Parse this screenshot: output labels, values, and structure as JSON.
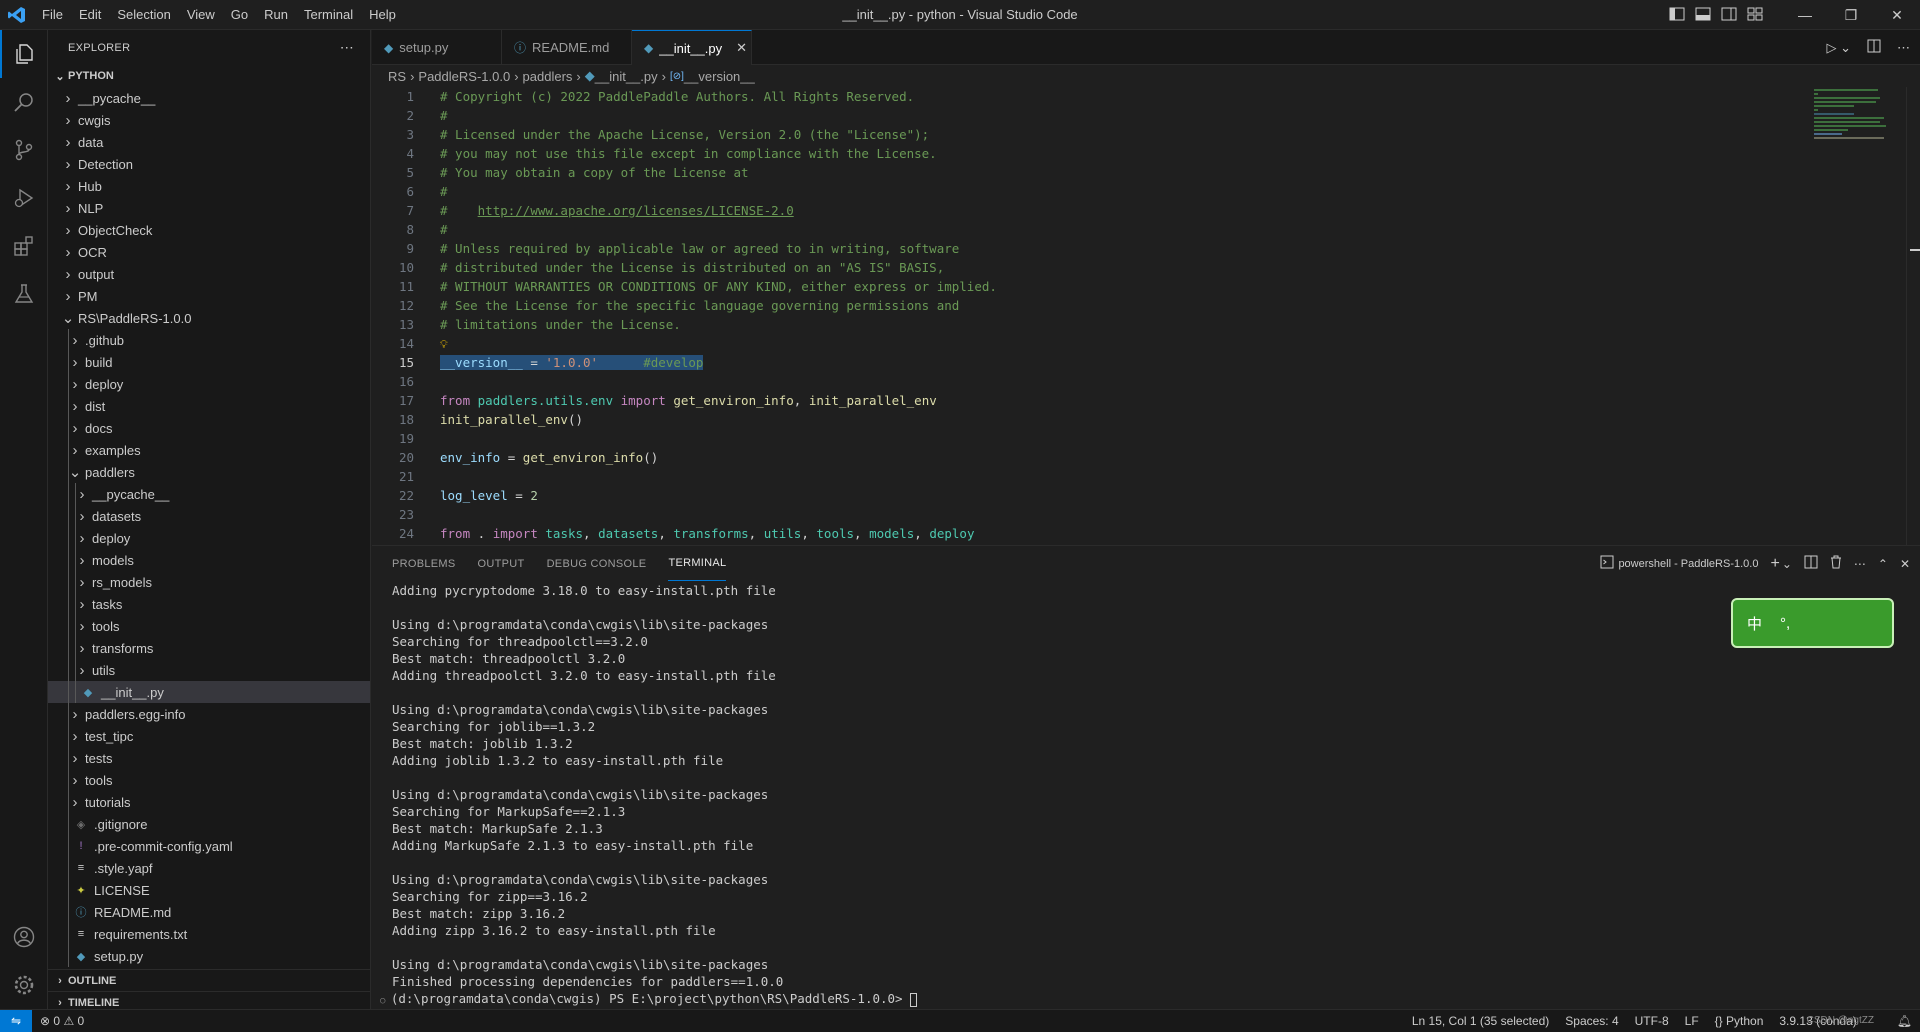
{
  "titlebar": {
    "menu": [
      "File",
      "Edit",
      "Selection",
      "View",
      "Go",
      "Run",
      "Terminal",
      "Help"
    ],
    "title": "__init__.py - python - Visual Studio Code"
  },
  "sidebar": {
    "title": "EXPLORER",
    "root": "PYTHON",
    "tree": [
      {
        "label": "__pycache__",
        "depth": 0,
        "type": "folder"
      },
      {
        "label": "cwgis",
        "depth": 0,
        "type": "folder"
      },
      {
        "label": "data",
        "depth": 0,
        "type": "folder"
      },
      {
        "label": "Detection",
        "depth": 0,
        "type": "folder"
      },
      {
        "label": "Hub",
        "depth": 0,
        "type": "folder"
      },
      {
        "label": "NLP",
        "depth": 0,
        "type": "folder"
      },
      {
        "label": "ObjectCheck",
        "depth": 0,
        "type": "folder"
      },
      {
        "label": "OCR",
        "depth": 0,
        "type": "folder"
      },
      {
        "label": "output",
        "depth": 0,
        "type": "folder"
      },
      {
        "label": "PM",
        "depth": 0,
        "type": "folder"
      },
      {
        "label": "RS\\PaddleRS-1.0.0",
        "depth": 0,
        "type": "open"
      },
      {
        "label": ".github",
        "depth": 1,
        "type": "folder"
      },
      {
        "label": "build",
        "depth": 1,
        "type": "folder"
      },
      {
        "label": "deploy",
        "depth": 1,
        "type": "folder"
      },
      {
        "label": "dist",
        "depth": 1,
        "type": "folder"
      },
      {
        "label": "docs",
        "depth": 1,
        "type": "folder"
      },
      {
        "label": "examples",
        "depth": 1,
        "type": "folder"
      },
      {
        "label": "paddlers",
        "depth": 1,
        "type": "open"
      },
      {
        "label": "__pycache__",
        "depth": 2,
        "type": "folder"
      },
      {
        "label": "datasets",
        "depth": 2,
        "type": "folder"
      },
      {
        "label": "deploy",
        "depth": 2,
        "type": "folder"
      },
      {
        "label": "models",
        "depth": 2,
        "type": "folder"
      },
      {
        "label": "rs_models",
        "depth": 2,
        "type": "folder"
      },
      {
        "label": "tasks",
        "depth": 2,
        "type": "folder"
      },
      {
        "label": "tools",
        "depth": 2,
        "type": "folder"
      },
      {
        "label": "transforms",
        "depth": 2,
        "type": "folder"
      },
      {
        "label": "utils",
        "depth": 2,
        "type": "folder"
      },
      {
        "label": "__init__.py",
        "depth": 2,
        "type": "py",
        "selected": true
      },
      {
        "label": "paddlers.egg-info",
        "depth": 1,
        "type": "folder"
      },
      {
        "label": "test_tipc",
        "depth": 1,
        "type": "folder"
      },
      {
        "label": "tests",
        "depth": 1,
        "type": "folder"
      },
      {
        "label": "tools",
        "depth": 1,
        "type": "folder"
      },
      {
        "label": "tutorials",
        "depth": 1,
        "type": "folder"
      },
      {
        "label": ".gitignore",
        "depth": 1,
        "type": "git"
      },
      {
        "label": ".pre-commit-config.yaml",
        "depth": 1,
        "type": "yaml"
      },
      {
        "label": ".style.yapf",
        "depth": 1,
        "type": "lines"
      },
      {
        "label": "LICENSE",
        "depth": 1,
        "type": "license"
      },
      {
        "label": "README.md",
        "depth": 1,
        "type": "info"
      },
      {
        "label": "requirements.txt",
        "depth": 1,
        "type": "lines"
      },
      {
        "label": "setup.py",
        "depth": 1,
        "type": "py"
      }
    ],
    "outline": "OUTLINE",
    "timeline": "TIMELINE"
  },
  "tabs": [
    {
      "label": "setup.py",
      "icon": "python-icon",
      "active": false
    },
    {
      "label": "README.md",
      "icon": "info-icon",
      "active": false
    },
    {
      "label": "__init__.py",
      "icon": "python-icon",
      "active": true
    }
  ],
  "breadcrumb": [
    "RS",
    "PaddleRS-1.0.0",
    "paddlers",
    "__init__.py",
    "__version__"
  ],
  "code": [
    [
      {
        "t": "# Copyright (c) 2022 PaddlePaddle Authors. All Rights Reserved.",
        "c": "c-com"
      }
    ],
    [
      {
        "t": "#",
        "c": "c-com"
      }
    ],
    [
      {
        "t": "# Licensed under the Apache License, Version 2.0 (the \"License\");",
        "c": "c-com"
      }
    ],
    [
      {
        "t": "# you may not use this file except in compliance with the License.",
        "c": "c-com"
      }
    ],
    [
      {
        "t": "# You may obtain a copy of the License at",
        "c": "c-com"
      }
    ],
    [
      {
        "t": "#",
        "c": "c-com"
      }
    ],
    [
      {
        "t": "#    ",
        "c": "c-com"
      },
      {
        "t": "http://www.apache.org/licenses/LICENSE-2.0",
        "c": "c-link"
      }
    ],
    [
      {
        "t": "#",
        "c": "c-com"
      }
    ],
    [
      {
        "t": "# Unless required by applicable law or agreed to in writing, software",
        "c": "c-com"
      }
    ],
    [
      {
        "t": "# distributed under the License is distributed on an \"AS IS\" BASIS,",
        "c": "c-com"
      }
    ],
    [
      {
        "t": "# WITHOUT WARRANTIES OR CONDITIONS OF ANY KIND, either express or implied.",
        "c": "c-com"
      }
    ],
    [
      {
        "t": "# See the License for the specific language governing permissions and",
        "c": "c-com"
      }
    ],
    [
      {
        "t": "# limitations under the License.",
        "c": "c-com"
      }
    ],
    [
      {
        "t": "",
        "c": "c-def"
      }
    ],
    [
      {
        "t": "__version__",
        "c": "c-var selbg"
      },
      {
        "t": " = ",
        "c": "c-def selbg"
      },
      {
        "t": "'1.0.0'",
        "c": "c-str selbg"
      },
      {
        "t": "      ",
        "c": "c-def selbg"
      },
      {
        "t": "#develop",
        "c": "c-com selbg"
      }
    ],
    [
      {
        "t": "",
        "c": "c-def"
      }
    ],
    [
      {
        "t": "from ",
        "c": "c-kw"
      },
      {
        "t": "paddlers.utils.env",
        "c": "c-mod"
      },
      {
        "t": " import ",
        "c": "c-kw"
      },
      {
        "t": "get_environ_info",
        "c": "c-fn"
      },
      {
        "t": ", ",
        "c": "c-def"
      },
      {
        "t": "init_parallel_env",
        "c": "c-fn"
      }
    ],
    [
      {
        "t": "init_parallel_env",
        "c": "c-fn"
      },
      {
        "t": "()",
        "c": "c-def"
      }
    ],
    [
      {
        "t": "",
        "c": "c-def"
      }
    ],
    [
      {
        "t": "env_info",
        "c": "c-var"
      },
      {
        "t": " = ",
        "c": "c-def"
      },
      {
        "t": "get_environ_info",
        "c": "c-fn"
      },
      {
        "t": "()",
        "c": "c-def"
      }
    ],
    [
      {
        "t": "",
        "c": "c-def"
      }
    ],
    [
      {
        "t": "log_level",
        "c": "c-var"
      },
      {
        "t": " = ",
        "c": "c-def"
      },
      {
        "t": "2",
        "c": "c-num"
      }
    ],
    [
      {
        "t": "",
        "c": "c-def"
      }
    ],
    [
      {
        "t": "from ",
        "c": "c-kw"
      },
      {
        "t": ". ",
        "c": "c-def"
      },
      {
        "t": "import ",
        "c": "c-kw"
      },
      {
        "t": "tasks",
        "c": "c-mod"
      },
      {
        "t": ", ",
        "c": "c-def"
      },
      {
        "t": "datasets",
        "c": "c-mod"
      },
      {
        "t": ", ",
        "c": "c-def"
      },
      {
        "t": "transforms",
        "c": "c-mod"
      },
      {
        "t": ", ",
        "c": "c-def"
      },
      {
        "t": "utils",
        "c": "c-mod"
      },
      {
        "t": ", ",
        "c": "c-def"
      },
      {
        "t": "tools",
        "c": "c-mod"
      },
      {
        "t": ", ",
        "c": "c-def"
      },
      {
        "t": "models",
        "c": "c-mod"
      },
      {
        "t": ", ",
        "c": "c-def"
      },
      {
        "t": "deploy",
        "c": "c-mod"
      }
    ]
  ],
  "current_line": 15,
  "panel": {
    "tabs": [
      "PROBLEMS",
      "OUTPUT",
      "DEBUG CONSOLE",
      "TERMINAL"
    ],
    "active_tab": "TERMINAL",
    "terminal_name": "powershell - PaddleRS-1.0.0",
    "lines": [
      "Adding pycryptodome 3.18.0 to easy-install.pth file",
      "",
      "Using d:\\programdata\\conda\\cwgis\\lib\\site-packages",
      "Searching for threadpoolctl==3.2.0",
      "Best match: threadpoolctl 3.2.0",
      "Adding threadpoolctl 3.2.0 to easy-install.pth file",
      "",
      "Using d:\\programdata\\conda\\cwgis\\lib\\site-packages",
      "Searching for joblib==1.3.2",
      "Best match: joblib 1.3.2",
      "Adding joblib 1.3.2 to easy-install.pth file",
      "",
      "Using d:\\programdata\\conda\\cwgis\\lib\\site-packages",
      "Searching for MarkupSafe==2.1.3",
      "Best match: MarkupSafe 2.1.3",
      "Adding MarkupSafe 2.1.3 to easy-install.pth file",
      "",
      "Using d:\\programdata\\conda\\cwgis\\lib\\site-packages",
      "Searching for zipp==3.16.2",
      "Best match: zipp 3.16.2",
      "Adding zipp 3.16.2 to easy-install.pth file",
      "",
      "Using d:\\programdata\\conda\\cwgis\\lib\\site-packages",
      "Finished processing dependencies for paddlers==1.0.0"
    ],
    "prompt": "(d:\\programdata\\conda\\cwgis) PS E:\\project\\python\\RS\\PaddleRS-1.0.0> "
  },
  "ime": {
    "mode": "中",
    "punct": "°,"
  },
  "statusbar": {
    "errors": "0",
    "warnings": "0",
    "position": "Ln 15, Col 1 (35 selected)",
    "spaces": "Spaces: 4",
    "encoding": "UTF-8",
    "eol": "LF",
    "language": "Python",
    "interpreter": "3.9.13 (conda)",
    "watermark": "CSDN @ngtZZ"
  },
  "colors": {
    "accent": "#0078d4",
    "bg": "#1f1f1f",
    "sidebar": "#181818"
  }
}
